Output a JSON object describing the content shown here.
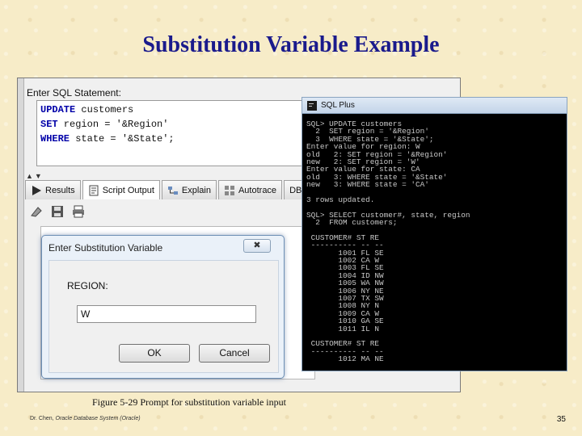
{
  "slide": {
    "title": "Substitution Variable Example",
    "caption": "Figure 5-29    Prompt for substitution variable input",
    "footer_author": "Dr. Chen, ",
    "footer_course": "Oracle Database System (Oracle)",
    "page_number": "35"
  },
  "sql_developer": {
    "editor_label": "Enter SQL Statement:",
    "editor_lines": [
      {
        "keyword": "UPDATE",
        "rest": " customers"
      },
      {
        "keyword": " SET",
        "rest": " region = '&Region'"
      },
      {
        "keyword": " WHERE",
        "rest": " state = '&State';"
      }
    ],
    "splitter_arrows": "▲▼",
    "tabs": [
      {
        "label": "Results",
        "icon": "play-icon"
      },
      {
        "label": "Script Output",
        "icon": "script-icon"
      },
      {
        "label": "Explain",
        "icon": "explain-icon"
      },
      {
        "label": "Autotrace",
        "icon": "autotrace-icon"
      },
      {
        "label": "DBM",
        "icon": "dbms-icon"
      }
    ]
  },
  "dialog": {
    "title": "Enter Substitution Variable",
    "close_glyph": "✖",
    "label": "REGION:",
    "value": "W",
    "ok_label": "OK",
    "cancel_label": "Cancel"
  },
  "sqlplus": {
    "title": "SQL Plus",
    "lines": [
      "SQL> UPDATE customers",
      "  2  SET region = '&Region'",
      "  3  WHERE state = '&State';",
      "Enter value for region: W",
      "old   2: SET region = '&Region'",
      "new   2: SET region = 'W'",
      "Enter value for state: CA",
      "old   3: WHERE state = '&State'",
      "new   3: WHERE state = 'CA'",
      "",
      "3 rows updated.",
      "",
      "SQL> SELECT customer#, state, region",
      "  2  FROM customers;",
      "",
      " CUSTOMER# ST RE",
      " ---------- -- --",
      "       1001 FL SE",
      "       1002 CA W",
      "       1003 FL SE",
      "       1004 ID NW",
      "       1005 WA NW",
      "       1006 NY NE",
      "       1007 TX SW",
      "       1008 NY N",
      "       1009 CA W",
      "       1010 GA SE",
      "       1011 IL N",
      "",
      " CUSTOMER# ST RE",
      " ---------- -- --",
      "       1012 MA NE"
    ]
  },
  "colors": {
    "title": "#1a1a8c",
    "background": "#f7ecc8",
    "sql_keyword": "#0000a8",
    "console_bg": "#000000",
    "console_text": "#c8c8c8"
  }
}
